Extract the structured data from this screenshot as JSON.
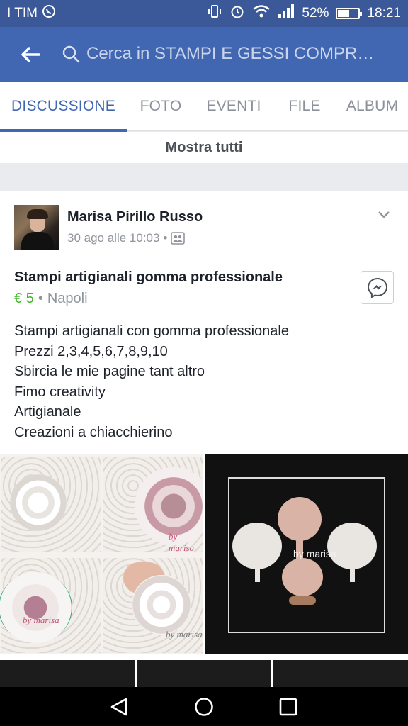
{
  "status": {
    "carrier": "I TIM",
    "battery_percent": "52%",
    "battery_level": 0.52,
    "time": "18:21"
  },
  "search": {
    "placeholder": "Cerca in STAMPI E GESSI COMPR…"
  },
  "tabs": [
    {
      "label": "DISCUSSIONE",
      "active": true
    },
    {
      "label": "FOTO",
      "active": false
    },
    {
      "label": "EVENTI",
      "active": false
    },
    {
      "label": "FILE",
      "active": false
    },
    {
      "label": "ALBUM",
      "active": false
    }
  ],
  "show_all": "Mostra tutti",
  "post": {
    "author": "Marisa Pirillo Russo",
    "date": "30 ago alle 10:03",
    "separator": "•",
    "title": "Stampi artigianali gomma professionale",
    "price": "€ 5",
    "location": "Napoli",
    "body": [
      "Stampi artigianali con gomma professionale",
      "Prezzi 2,3,4,5,6,7,8,9,10",
      "Sbircia le mie pagine tant altro",
      "Fimo creativity",
      "Artigianale",
      "Creazioni a chiacchierino"
    ],
    "photo_watermark": "by marisa"
  },
  "colors": {
    "status_bar": "#3b5998",
    "app_bar": "#4267b2",
    "accent": "#4267b2",
    "price": "#42b72a"
  }
}
